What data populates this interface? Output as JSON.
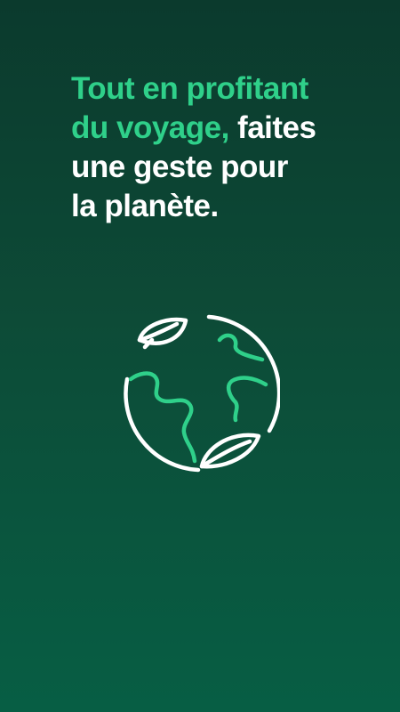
{
  "onboarding": {
    "headline": {
      "line1_accent": "Tout en profitant",
      "line2_accent": "du voyage,",
      "line2_plain": " faites",
      "line3_plain": "une geste pour",
      "line4_plain": "la planète."
    },
    "illustration_icon": "globe-with-leaves-icon"
  },
  "colors": {
    "background_top": "#0b3a2d",
    "background_bottom": "#075e44",
    "accent": "#2fd08a",
    "text": "#ffffff"
  }
}
